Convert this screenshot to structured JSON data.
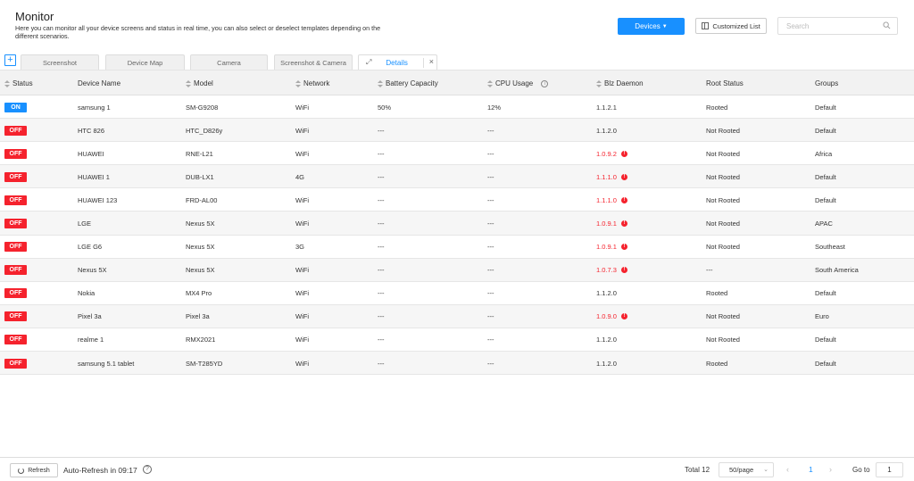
{
  "header": {
    "title": "Monitor",
    "description": "Here you can monitor all your device screens and status in real time, you can also select or deselect templates depending on the different scenarios.",
    "devices_button": "Devices",
    "customized_list_button": "Customized List",
    "search_placeholder": "Search"
  },
  "tabs": [
    {
      "label": "Screenshot"
    },
    {
      "label": "Device Map"
    },
    {
      "label": "Camera"
    },
    {
      "label": "Screenshot & Camera"
    },
    {
      "label": "Details",
      "active": true
    }
  ],
  "table": {
    "columns": [
      "Status",
      "Device Name",
      "Model",
      "Network",
      "Battery Capacity",
      "CPU Usage",
      "Blz Daemon",
      "Root Status",
      "Groups"
    ],
    "rows": [
      {
        "status": "ON",
        "name": "samsung 1",
        "model": "SM-G9208",
        "network": "WiFi",
        "battery": "50%",
        "cpu": "12%",
        "daemon": "1.1.2.1",
        "daemon_warning": false,
        "root": "Rooted",
        "group": "Default"
      },
      {
        "status": "OFF",
        "name": "HTC 826",
        "model": "HTC_D826y",
        "network": "WiFi",
        "battery": "---",
        "cpu": "---",
        "daemon": "1.1.2.0",
        "daemon_warning": false,
        "root": "Not Rooted",
        "group": "Default"
      },
      {
        "status": "OFF",
        "name": "HUAWEI",
        "model": "RNE-L21",
        "network": "WiFi",
        "battery": "---",
        "cpu": "---",
        "daemon": "1.0.9.2",
        "daemon_warning": true,
        "root": "Not Rooted",
        "group": "Africa"
      },
      {
        "status": "OFF",
        "name": "HUAWEI 1",
        "model": "DUB-LX1",
        "network": "4G",
        "battery": "---",
        "cpu": "---",
        "daemon": "1.1.1.0",
        "daemon_warning": true,
        "root": "Not Rooted",
        "group": "Default"
      },
      {
        "status": "OFF",
        "name": "HUAWEI 123",
        "model": "FRD-AL00",
        "network": "WiFi",
        "battery": "---",
        "cpu": "---",
        "daemon": "1.1.1.0",
        "daemon_warning": true,
        "root": "Not Rooted",
        "group": "Default"
      },
      {
        "status": "OFF",
        "name": "LGE",
        "model": "Nexus 5X",
        "network": "WiFi",
        "battery": "---",
        "cpu": "---",
        "daemon": "1.0.9.1",
        "daemon_warning": true,
        "root": "Not Rooted",
        "group": "APAC"
      },
      {
        "status": "OFF",
        "name": "LGE G6",
        "model": "Nexus 5X",
        "network": "3G",
        "battery": "---",
        "cpu": "---",
        "daemon": "1.0.9.1",
        "daemon_warning": true,
        "root": "Not Rooted",
        "group": "Southeast"
      },
      {
        "status": "OFF",
        "name": "Nexus 5X",
        "model": "Nexus 5X",
        "network": "WiFi",
        "battery": "---",
        "cpu": "---",
        "daemon": "1.0.7.3",
        "daemon_warning": true,
        "root": "---",
        "group": "South America"
      },
      {
        "status": "OFF",
        "name": "Nokia",
        "model": "MX4 Pro",
        "network": "WiFi",
        "battery": "---",
        "cpu": "---",
        "daemon": "1.1.2.0",
        "daemon_warning": false,
        "root": "Rooted",
        "group": "Default"
      },
      {
        "status": "OFF",
        "name": "Pixel 3a",
        "model": "Pixel 3a",
        "network": "WiFi",
        "battery": "---",
        "cpu": "---",
        "daemon": "1.0.9.0",
        "daemon_warning": true,
        "root": "Not Rooted",
        "group": "Euro"
      },
      {
        "status": "OFF",
        "name": "realme 1",
        "model": "RMX2021",
        "network": "WiFi",
        "battery": "---",
        "cpu": "---",
        "daemon": "1.1.2.0",
        "daemon_warning": false,
        "root": "Not Rooted",
        "group": "Default"
      },
      {
        "status": "OFF",
        "name": "samsung 5.1 tablet",
        "model": "SM-T285YD",
        "network": "WiFi",
        "battery": "---",
        "cpu": "---",
        "daemon": "1.1.2.0",
        "daemon_warning": false,
        "root": "Rooted",
        "group": "Default"
      }
    ]
  },
  "footer": {
    "refresh_button": "Refresh",
    "auto_refresh": "Auto-Refresh in 09:17",
    "total": "Total 12",
    "page_size": "50/page",
    "current_page": "1",
    "goto_label": "Go to",
    "goto_value": "1"
  },
  "colors": {
    "accent": "#1890ff",
    "danger": "#f5222d"
  }
}
